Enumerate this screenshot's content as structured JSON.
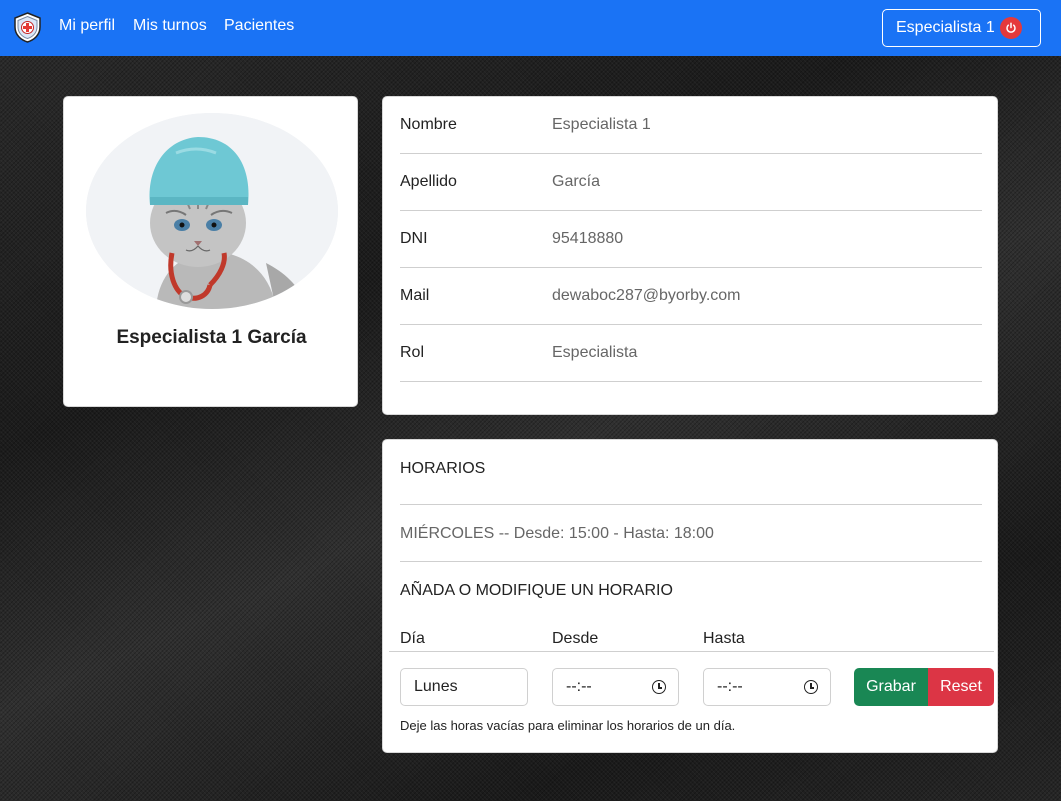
{
  "nav": {
    "logo_icon": "medical-shield-icon",
    "links": [
      "Mi perfil",
      "Mis turnos",
      "Pacientes"
    ],
    "user_button": "Especialista 1",
    "logout_icon": "power-icon",
    "bg_color": "#1a73f5"
  },
  "profile": {
    "avatar_icon": "cat-doctor-avatar",
    "full_name": "Especialista 1 García"
  },
  "info": {
    "rows": [
      {
        "label": "Nombre",
        "value": "Especialista 1"
      },
      {
        "label": "Apellido",
        "value": "García"
      },
      {
        "label": "DNI",
        "value": "95418880"
      },
      {
        "label": "Mail",
        "value": "dewaboc287@byorby.com"
      },
      {
        "label": "Rol",
        "value": "Especialista"
      }
    ]
  },
  "schedule": {
    "title": "HORARIOS",
    "entries": [
      "MIÉRCOLES -- Desde: 15:00 - Hasta: 18:00"
    ],
    "form_title": "AÑADA O MODIFIQUE UN HORARIO",
    "columns": {
      "day": "Día",
      "from": "Desde",
      "to": "Hasta"
    },
    "day_value": "Lunes",
    "from_value": "--:--",
    "to_value": "--:--",
    "save_label": "Grabar",
    "reset_label": "Reset",
    "hint": "Deje las horas vacías para eliminar los horarios de un día.",
    "save_color": "#198754",
    "reset_color": "#dc3545"
  }
}
